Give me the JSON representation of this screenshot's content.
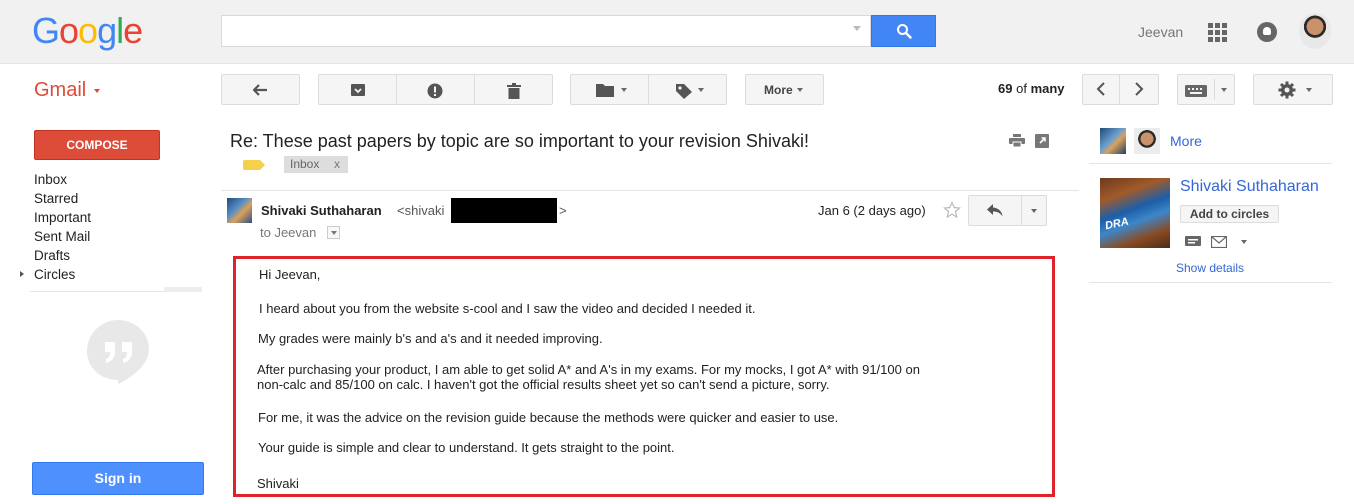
{
  "header": {
    "logo_text": "Google",
    "logo_colors": [
      "#4285f4",
      "#ea4335",
      "#fbbc05",
      "#4285f4",
      "#34a853",
      "#ea4335"
    ],
    "search_placeholder": "",
    "user_name": "Jeevan"
  },
  "app": {
    "title": "Gmail"
  },
  "toolbar": {
    "more_label": "More",
    "count_current": "69",
    "count_of": "of",
    "count_total": "many",
    "icons": [
      "back-icon",
      "archive-icon",
      "report-spam-icon",
      "delete-icon",
      "folder-icon",
      "label-icon",
      "prev-icon",
      "next-icon",
      "keyboard-icon",
      "settings-icon"
    ]
  },
  "sidebar": {
    "compose_label": "COMPOSE",
    "items": [
      {
        "label": "Inbox"
      },
      {
        "label": "Starred"
      },
      {
        "label": "Important"
      },
      {
        "label": "Sent Mail"
      },
      {
        "label": "Drafts"
      },
      {
        "label": "Circles"
      }
    ],
    "sign_in_label": "Sign in"
  },
  "thread": {
    "subject": "Re: These past papers by topic are so important to your revision Shivaki!",
    "label": "Inbox",
    "label_remove": "x"
  },
  "message": {
    "sender_name": "Shivaki Suthaharan",
    "sender_email_prefix": "<shivaki",
    "sender_email_suffix": ">",
    "to_line": "to Jeevan",
    "date": "Jan 6 (2 days ago)",
    "body": [
      "Hi Jeevan,",
      "I heard about you from the website s-cool and I saw the video and decided I needed it.",
      "My grades were mainly b's and a's and it needed improving.",
      "After purchasing your product, I am able to get solid A* and A's in my exams. For my mocks, I got A* with 91/100 on",
      "non-calc and 85/100 on calc. I haven't got the official results sheet yet so can't send a picture, sorry.",
      "For me, it was the advice on the revision guide because the methods were quicker and easier to use.",
      "Your guide is simple and clear to understand. It gets straight to the point.",
      "Shivaki"
    ],
    "highlight_color": "#e0232b"
  },
  "people": {
    "more_label": "More",
    "contact_name": "Shivaki Suthaharan",
    "photo_caption": "DRA",
    "add_circles_label": "Add to circles",
    "show_details_label": "Show details"
  }
}
